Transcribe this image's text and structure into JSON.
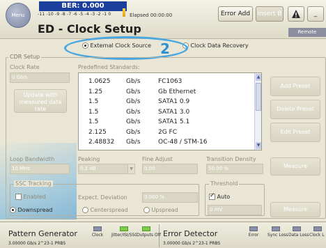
{
  "header": {
    "menu_label": "Menu",
    "ber": "BER: 0.000",
    "scale": "-11 -10 -9 -8 -7 -6 -5 -4 -3 -2 -1 0",
    "elapsed": "Elapsed 00:00:00",
    "title": "ED - Clock Setup",
    "error_add": "Error Add",
    "insert": "Insert B",
    "warning_icon": "warning-triangle-icon",
    "minimize": "_",
    "remote": "Remote"
  },
  "clock_source": {
    "external": "External Clock Source",
    "recovery": "Clock Data Recovery",
    "selected": "external",
    "callout": "2"
  },
  "cdr": {
    "group_title": "CDR Setup",
    "clock_rate_label": "Clock Rate",
    "clock_rate_value": "0 Gb/s",
    "update_button": "Update with measured data rate",
    "predefined_label": "Predefined Standards:",
    "standards": [
      {
        "rate": "1.0625",
        "unit": "Gb/s",
        "name": "FC1063"
      },
      {
        "rate": "1.25",
        "unit": "Gb/s",
        "name": "Gb Ethernet"
      },
      {
        "rate": "1.5",
        "unit": "Gb/s",
        "name": "SATA1 0.9"
      },
      {
        "rate": "1.5",
        "unit": "Gb/s",
        "name": "SATA1 3.0"
      },
      {
        "rate": "1.5",
        "unit": "Gb/s",
        "name": "SATA1 5.1"
      },
      {
        "rate": "2.125",
        "unit": "Gb/s",
        "name": "2G FC"
      },
      {
        "rate": "2.48832",
        "unit": "Gb/s",
        "name": "OC-48 / STM-16"
      }
    ],
    "add_preset": "Add Preset",
    "delete_preset": "Delete Preset",
    "edit_preset": "Edit Preset",
    "loop_bw_label": "Loop Bandwidth",
    "loop_bw_value": "10 MHz",
    "peaking_label": "Peaking",
    "peaking_value": "0.1 dB",
    "fine_adjust_label": "Fine Adjust",
    "fine_adjust_value": "0.00",
    "transition_label": "Transition Density",
    "transition_value": "50.00 %",
    "measure": "Measure"
  },
  "ssc": {
    "title": "SSC Tracking",
    "enabled": "Enabled",
    "expect_dev_label": "Expect. Deviation",
    "expect_dev_value": "0.000 %",
    "downspread": "Downspread",
    "centerspread": "Centerspread",
    "upspread": "Upspread",
    "selected": "downspread"
  },
  "threshold": {
    "title": "Threshold",
    "auto": "Auto",
    "auto_checked": true,
    "value": "0 mV",
    "measure": "Measure"
  },
  "status": {
    "pg_title": "Pattern Generator",
    "pg_sub": "3.00000 Gb/s   2^23-1 PRBS",
    "pg_leds": [
      "Clock",
      "Jitter/ISI/SSC",
      "Outputs Off"
    ],
    "ed_title": "Error Detector",
    "ed_sub": "3.00000 Gb/s   2^23-1 PRBS",
    "ed_leds": [
      "Error",
      "Sync Loss",
      "Data Loss",
      "Clock Loss"
    ]
  },
  "colors": {
    "ber_bg": "#1b3f9c",
    "highlight": "#4aa6df",
    "led_green": "#7ecb4a"
  }
}
